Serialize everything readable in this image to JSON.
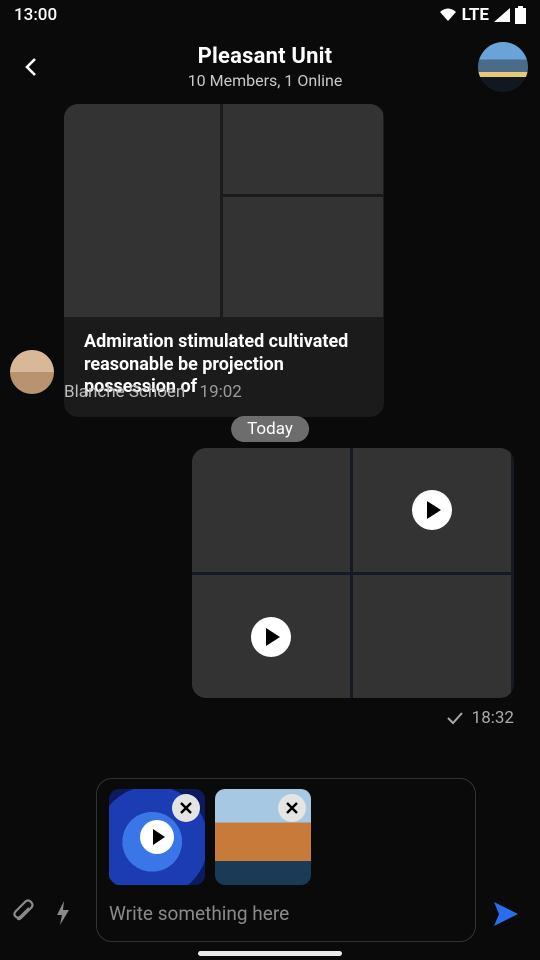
{
  "status": {
    "time": "13:00",
    "network": "LTE"
  },
  "header": {
    "title": "Pleasant Unit",
    "subtitle": "10 Members, 1 Online"
  },
  "messages": {
    "first": {
      "text": "Admiration stimulated cultivated reasonable be projection possession of",
      "sender": "Blanche Schoen",
      "time": "19:02"
    },
    "date_separator": "Today",
    "second": {
      "time": "18:32"
    }
  },
  "composer": {
    "placeholder": "Write something here"
  },
  "icons": {
    "back": "back-icon",
    "wifi": "wifi-icon",
    "signal": "signal-icon",
    "battery": "battery-icon",
    "check": "check-icon",
    "attach": "attach-icon",
    "bolt": "bolt-icon",
    "send": "send-icon",
    "close": "close-icon",
    "play": "play-icon"
  }
}
